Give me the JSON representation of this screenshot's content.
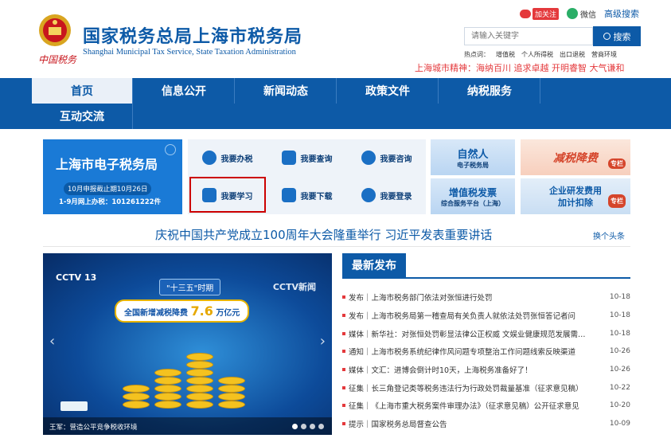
{
  "header": {
    "site_title": "国家税务总局上海市税务局",
    "site_subtitle": "Shanghai Municipal Tax Service, State Taxation Administration",
    "brand_text": "中国税务",
    "weibo_follow": "加关注",
    "wechat_label": "微信",
    "advanced_search": "高级搜索",
    "search_placeholder": "请输入关键字",
    "search_button": "搜索",
    "hot_words_label": "热点词：",
    "hot_words": [
      "增值税",
      "个人所得税",
      "出口退税",
      "营商环境"
    ],
    "city_spirit": "上海城市精神：海纳百川 追求卓越 开明睿智 大气谦和"
  },
  "nav": {
    "items": [
      "首页",
      "信息公开",
      "新闻动态",
      "政策文件",
      "纳税服务",
      "互动交流"
    ]
  },
  "etax": {
    "title": "上海市电子税务局",
    "line1": "10月申报截止期10月26日",
    "line2": "1-9月网上办税：101261222件"
  },
  "services": [
    "我要办税",
    "我要查询",
    "我要咨询",
    "我要学习",
    "我要下载",
    "我要登录"
  ],
  "promos": {
    "a_title": "自然人",
    "a_sub": "电子税务局",
    "b_title": "减税降费",
    "b_tag": "专栏",
    "c_title": "增值税发票",
    "c_sub": "综合服务平台（上海）",
    "d_title": "企业研发费用",
    "d_title2": "加计扣除",
    "d_tag": "专栏"
  },
  "headline": {
    "text": "庆祝中国共产党成立100周年大会隆重举行 习近平发表重要讲话",
    "change": "换个头条"
  },
  "carousel": {
    "cctv_left": "CCTV 13",
    "cctv_right": "CCTV新闻",
    "badge": "\"十三五\"时期",
    "banner_prefix": "全国新增减税降费",
    "banner_number": "7.6",
    "banner_suffix": "万亿元",
    "caption": "王军：营造公平竞争税收环境",
    "prev": "‹",
    "next": "›"
  },
  "latest": {
    "tab": "最新发布",
    "items": [
      {
        "title": "发布｜上海市税务部门依法对张恒进行处罚",
        "date": "10-18"
      },
      {
        "title": "发布｜上海市税务局第一稽查局有关负责人就依法处罚张恒答记者问",
        "date": "10-18"
      },
      {
        "title": "媒体｜新华社：对张恒处罚彰显法律公正权威 文娱业健康规范发展需…",
        "date": "10-18"
      },
      {
        "title": "通知｜上海市税务系统纪律作风问题专项整治工作问题线索反映渠道",
        "date": "10-26"
      },
      {
        "title": "媒体｜文汇：进博会倒计时10天，上海税务准备好了！",
        "date": "10-26"
      },
      {
        "title": "征集｜长三角登记类等税务违法行为行政处罚裁量基准（征求意见稿）",
        "date": "10-22"
      },
      {
        "title": "征集｜《上海市重大税务案件审理办法》（征求意见稿）公开征求意见",
        "date": "10-20"
      },
      {
        "title": "提示｜国家税务总局督查公告",
        "date": "10-09"
      }
    ]
  }
}
